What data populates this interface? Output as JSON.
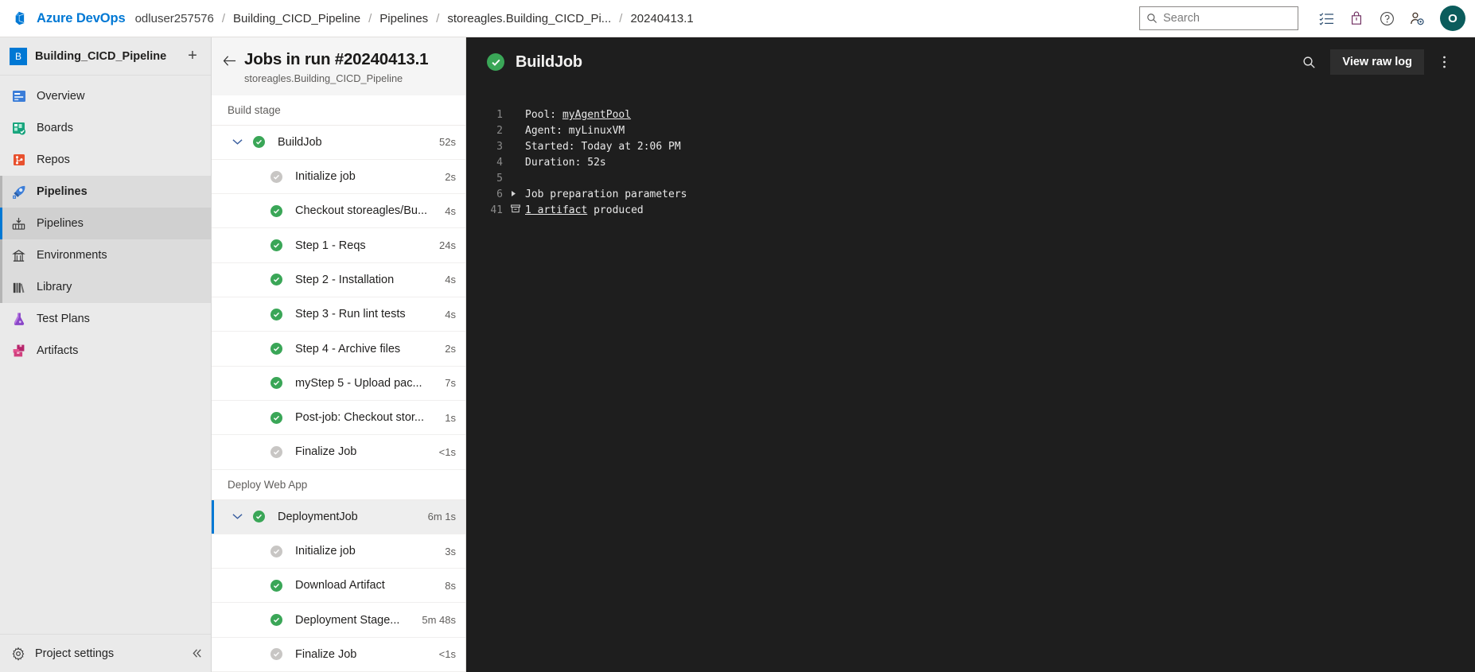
{
  "topbar": {
    "brand": "Azure DevOps",
    "logo_icon": "azure-devops-logo-icon",
    "breadcrumbs": [
      {
        "label": "odluser257576"
      },
      {
        "label": "Building_CICD_Pipeline"
      },
      {
        "label": "Pipelines"
      },
      {
        "label": "storeagles.Building_CICD_Pi..."
      },
      {
        "label": "20240413.1"
      }
    ],
    "separator": "/",
    "search": {
      "placeholder": "Search",
      "value": "",
      "icon": "search-icon"
    },
    "icons": [
      {
        "name": "checklist-icon",
        "label": "Work items"
      },
      {
        "name": "shopping-bag-icon",
        "label": "Marketplace"
      },
      {
        "name": "help-circle-icon",
        "label": "Help"
      },
      {
        "name": "user-settings-icon",
        "label": "User settings"
      }
    ],
    "avatar": {
      "initial": "O"
    }
  },
  "sidebar": {
    "project": {
      "initial": "B",
      "name": "Building_CICD_Pipeline",
      "add_label": "+"
    },
    "items": [
      {
        "label": "Overview",
        "icon": "overview-icon",
        "state": "normal"
      },
      {
        "label": "Boards",
        "icon": "boards-icon",
        "state": "normal"
      },
      {
        "label": "Repos",
        "icon": "repos-icon",
        "state": "normal"
      },
      {
        "label": "Pipelines",
        "icon": "pipelines-icon",
        "state": "group-active"
      },
      {
        "label": "Pipelines",
        "icon": "pipeline-run-icon",
        "state": "selected"
      },
      {
        "label": "Environments",
        "icon": "environments-icon",
        "state": "sub"
      },
      {
        "label": "Library",
        "icon": "library-icon",
        "state": "sub"
      },
      {
        "label": "Test Plans",
        "icon": "test-plans-icon",
        "state": "normal"
      },
      {
        "label": "Artifacts",
        "icon": "artifacts-icon",
        "state": "normal"
      }
    ],
    "footer": {
      "label": "Project settings",
      "icon": "gear-icon",
      "collapse_icon": "collapse-left-icon"
    }
  },
  "jobs_panel": {
    "back_icon": "back-arrow-icon",
    "title": "Jobs in run #20240413.1",
    "subtitle": "storeagles.Building_CICD_Pipeline",
    "stages": [
      {
        "stage_label": "Build stage",
        "jobs": [
          {
            "name": "BuildJob",
            "duration": "52s",
            "status": "succeeded",
            "selected": false,
            "expanded": true,
            "tasks": [
              {
                "name": "Initialize job",
                "duration": "2s",
                "status": "neutral"
              },
              {
                "name": "Checkout storeagles/Bu...",
                "duration": "4s",
                "status": "succeeded"
              },
              {
                "name": "Step 1 - Reqs",
                "duration": "24s",
                "status": "succeeded"
              },
              {
                "name": "Step 2 - Installation",
                "duration": "4s",
                "status": "succeeded"
              },
              {
                "name": "Step 3 - Run lint tests",
                "duration": "4s",
                "status": "succeeded"
              },
              {
                "name": "Step 4 - Archive files",
                "duration": "2s",
                "status": "succeeded"
              },
              {
                "name": "myStep 5 - Upload pac...",
                "duration": "7s",
                "status": "succeeded"
              },
              {
                "name": "Post-job: Checkout stor...",
                "duration": "1s",
                "status": "succeeded"
              },
              {
                "name": "Finalize Job",
                "duration": "<1s",
                "status": "neutral"
              }
            ]
          }
        ]
      },
      {
        "stage_label": "Deploy Web App",
        "jobs": [
          {
            "name": "DeploymentJob",
            "duration": "6m 1s",
            "status": "succeeded",
            "selected": true,
            "expanded": true,
            "tasks": [
              {
                "name": "Initialize job",
                "duration": "3s",
                "status": "neutral"
              },
              {
                "name": "Download Artifact",
                "duration": "8s",
                "status": "succeeded"
              },
              {
                "name": "Deployment Stage...",
                "duration": "5m 48s",
                "status": "succeeded"
              },
              {
                "name": "Finalize Job",
                "duration": "<1s",
                "status": "neutral"
              }
            ]
          }
        ]
      }
    ]
  },
  "log_panel": {
    "status": "succeeded",
    "title": "BuildJob",
    "search_icon": "search-icon",
    "raw_log_label": "View raw log",
    "more_icon": "more-vertical-icon",
    "lines": [
      {
        "num": "1",
        "gutter": "",
        "text": "Pool: ",
        "link": "myAgentPool",
        "after": ""
      },
      {
        "num": "2",
        "gutter": "",
        "text": "Agent: myLinuxVM"
      },
      {
        "num": "3",
        "gutter": "",
        "text": "Started: Today at 2:06 PM"
      },
      {
        "num": "4",
        "gutter": "",
        "text": "Duration: 52s"
      },
      {
        "num": "5",
        "gutter": "",
        "text": ""
      },
      {
        "num": "6",
        "gutter": "triangle",
        "text": "Job preparation parameters"
      },
      {
        "num": "41",
        "gutter": "artifact",
        "text": "",
        "link": "1 artifact",
        "after": " produced"
      }
    ]
  },
  "colors": {
    "brand_blue": "#0078d4",
    "success_green": "#3aa657",
    "neutral_gray": "#c8c6c4",
    "log_background": "#1e1e1e",
    "sidebar_background": "#eaeaea",
    "avatar_teal": "#0b5c5c"
  }
}
